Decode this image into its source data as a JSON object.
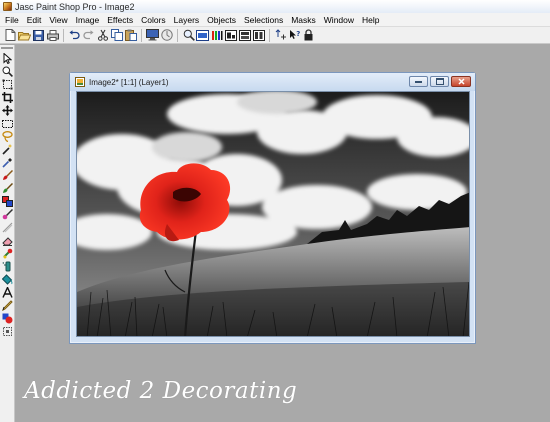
{
  "app": {
    "title": "Jasc Paint Shop Pro - Image2"
  },
  "menubar": {
    "items": [
      "File",
      "Edit",
      "View",
      "Image",
      "Effects",
      "Colors",
      "Layers",
      "Objects",
      "Selections",
      "Masks",
      "Window",
      "Help"
    ]
  },
  "toolbar": {
    "buttons": [
      "new-icon",
      "open-icon",
      "save-icon",
      "print-icon",
      "undo-icon",
      "redo-icon",
      "cut-icon",
      "copy-icon",
      "paste-icon",
      "monitor-icon",
      "browse-icon",
      "zoom-icon",
      "histogram-icon",
      "palette-icon",
      "overview-icon",
      "layers-icon",
      "tool-options-icon",
      "script-icon",
      "help-icon",
      "lock-icon"
    ]
  },
  "tools": {
    "items": [
      "arrow-icon",
      "zoom-tool-icon",
      "deform-icon",
      "crop-icon",
      "mover-icon",
      "selection-icon",
      "freehand-selection-icon",
      "magic-wand-icon",
      "dropper-icon",
      "paintbrush-icon",
      "clone-icon",
      "color-replacer-icon",
      "retouch-icon",
      "scratch-remover-icon",
      "eraser-icon",
      "picture-tube-icon",
      "airbrush-icon",
      "flood-fill-icon",
      "text-icon",
      "draw-icon",
      "preset-shapes-icon",
      "object-selector-icon"
    ]
  },
  "document": {
    "title": "Image2* [1:1] (Layer1)"
  },
  "colors": {
    "workspace": "#a9a9a9",
    "poppy": "#e01b10"
  },
  "watermark": {
    "text": "Addicted 2 Decorating"
  }
}
